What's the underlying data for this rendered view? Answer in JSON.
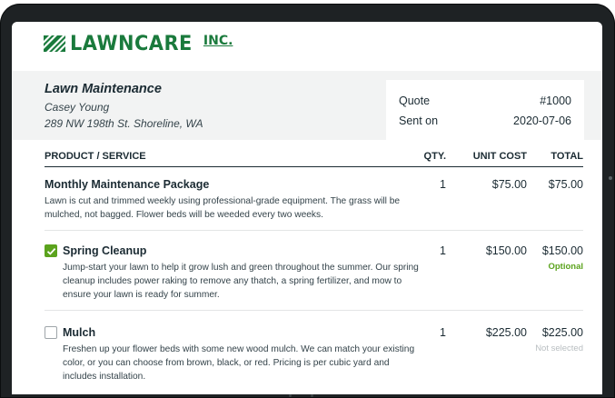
{
  "brand": {
    "name": "LAWNCARE",
    "suffix": "INC.",
    "color": "#1a7a3c"
  },
  "job": {
    "title": "Lawn Maintenance",
    "client": "Casey Young",
    "address": "289 NW 198th St. Shoreline, WA"
  },
  "quote": {
    "number_label": "Quote",
    "number": "#1000",
    "sent_label": "Sent on",
    "sent_date": "2020-07-06"
  },
  "table": {
    "headers": {
      "product": "PRODUCT / SERVICE",
      "qty": "QTY.",
      "unit_cost": "UNIT COST",
      "total": "TOTAL"
    },
    "rows": [
      {
        "name": "Monthly Maintenance Package",
        "description": "Lawn is cut and trimmed weekly using professional-grade equipment. The grass will be mulched, not bagged. Flower beds will be weeded every two weeks.",
        "qty": "1",
        "unit_cost": "$75.00",
        "total": "$75.00"
      },
      {
        "name": "Spring Cleanup",
        "description": "Jump-start your lawn to help it grow lush and green throughout the summer. Our spring cleanup includes power raking to remove any thatch, a spring fertilizer, and mow to ensure your lawn is ready for summer.",
        "qty": "1",
        "unit_cost": "$150.00",
        "total": "$150.00",
        "status": "Optional",
        "checked": true
      },
      {
        "name": "Mulch",
        "description": "Freshen up your flower beds with some new wood mulch. We can match your existing color, or you can choose from brown, black, or red. Pricing is per cubic yard and includes installation.",
        "qty": "1",
        "unit_cost": "$225.00",
        "total": "$225.00",
        "status": "Not selected",
        "checked": false
      }
    ]
  },
  "colors": {
    "accent_green": "#5ba31d",
    "text_dark": "#1b2b33",
    "band_gray": "#f2f3f3"
  }
}
